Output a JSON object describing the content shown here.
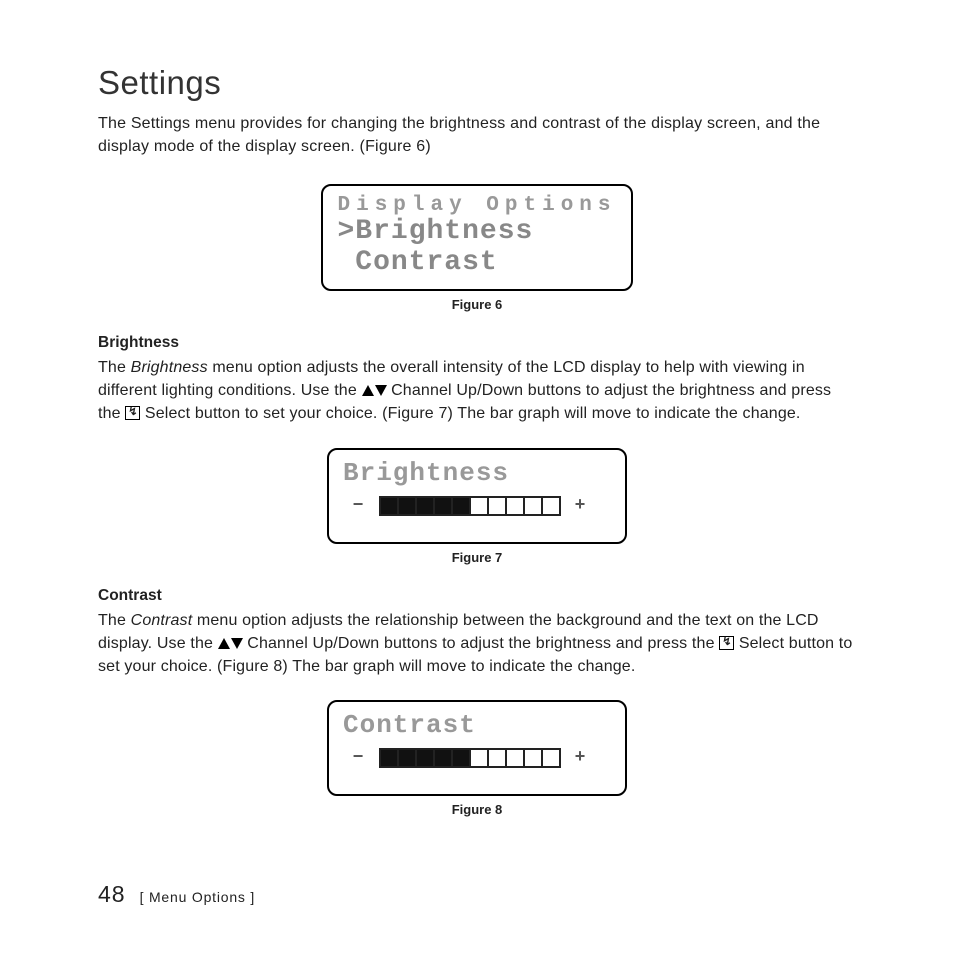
{
  "heading": "Settings",
  "intro": "The Settings menu provides for changing the brightness and contrast of the display screen, and the display mode of the display screen. (Figure 6)",
  "figure6": {
    "header": "Display Options",
    "line1": ">Brightness",
    "line2": " Contrast",
    "caption": "Figure 6"
  },
  "brightness": {
    "subhead": "Brightness",
    "text_a": "The ",
    "text_em": "Brightness",
    "text_b": " menu option adjusts the overall intensity of the LCD display to help with viewing in different lighting conditions. Use the ",
    "text_c": " Channel Up/Down buttons to adjust the brightness and press the ",
    "text_d": " Select button to set your choice. (Figure 7) The bar graph will move to indicate the change."
  },
  "figure7": {
    "title": "Brightness",
    "filled": 5,
    "total": 10,
    "minus": "−",
    "plus": "+",
    "caption": "Figure 7"
  },
  "contrast": {
    "subhead": "Contrast",
    "text_a": "The ",
    "text_em": "Contrast",
    "text_b": " menu option adjusts the relationship between the background and the text on the LCD display. Use the ",
    "text_c": " Channel Up/Down buttons to adjust the brightness and press the ",
    "text_d": " Select button to set your choice. (Figure 8) The bar graph will move to indicate the change."
  },
  "figure8": {
    "title": "Contrast",
    "filled": 5,
    "total": 10,
    "minus": "−",
    "plus": "+",
    "caption": "Figure 8"
  },
  "footer": {
    "page": "48",
    "section": "[ Menu Options ]"
  }
}
